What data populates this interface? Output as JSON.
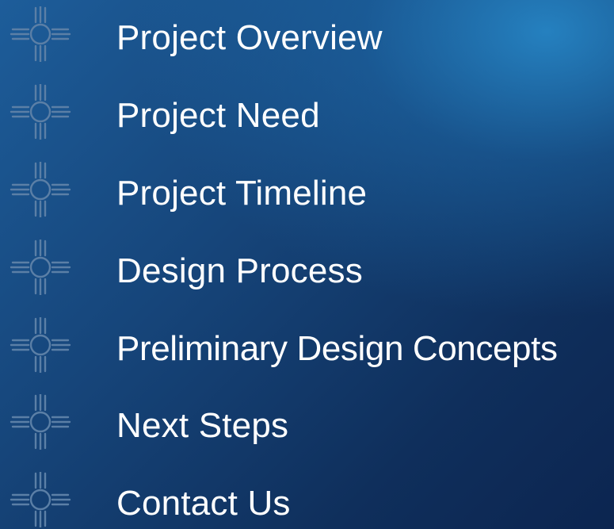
{
  "agenda": {
    "items": [
      {
        "label": "Project Overview",
        "icon": "zia-sun-symbol-icon"
      },
      {
        "label": "Project Need",
        "icon": "zia-sun-symbol-icon"
      },
      {
        "label": "Project Timeline",
        "icon": "zia-sun-symbol-icon"
      },
      {
        "label": "Design Process",
        "icon": "zia-sun-symbol-icon"
      },
      {
        "label": "Preliminary Design Concepts",
        "icon": "zia-sun-symbol-icon"
      },
      {
        "label": "Next Steps",
        "icon": "zia-sun-symbol-icon"
      },
      {
        "label": "Contact Us",
        "icon": "zia-sun-symbol-icon"
      }
    ]
  },
  "colors": {
    "text": "#ffffff",
    "icon": "#5b7fa6",
    "background_dark": "#0f2f5c",
    "background_light": "#2a8ccd"
  }
}
